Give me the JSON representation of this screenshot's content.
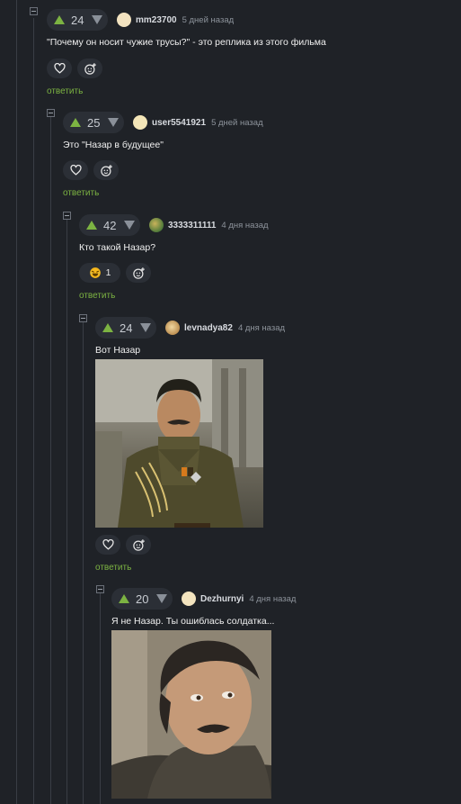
{
  "comments": [
    {
      "score": "24",
      "user": "mm23700",
      "time": "5 дней назад",
      "text": "\"Почему он носит чужие трусы?\" - это реплика из этого фильма",
      "reply": "ответить"
    },
    {
      "score": "25",
      "user": "user5541921",
      "time": "5 дней назад",
      "text": "Это \"Назар в будущее\"",
      "reply": "ответить"
    },
    {
      "score": "42",
      "user": "3333311111",
      "time": "4 дня назад",
      "text": "Кто такой Назар?",
      "reaction_count": "1",
      "reply": "ответить"
    },
    {
      "score": "24",
      "user": "levnadya82",
      "time": "4 дня назад",
      "text": "Вот Назар",
      "reply": "ответить"
    },
    {
      "score": "20",
      "user": "Dezhurnyi",
      "time": "4 дня назад",
      "text": "Я не Назар. Ты ошиблась солдатка..."
    }
  ],
  "colors": {
    "background": "#1f2227",
    "pill": "#2b2f36",
    "upvote": "#7cb342",
    "reply_link": "#7cb342",
    "thread_line": "#3a3e45"
  },
  "icons": [
    "collapse-icon",
    "upvote-icon",
    "downvote-icon",
    "heart-icon",
    "add-reaction-icon",
    "laughing-emoji-icon"
  ]
}
